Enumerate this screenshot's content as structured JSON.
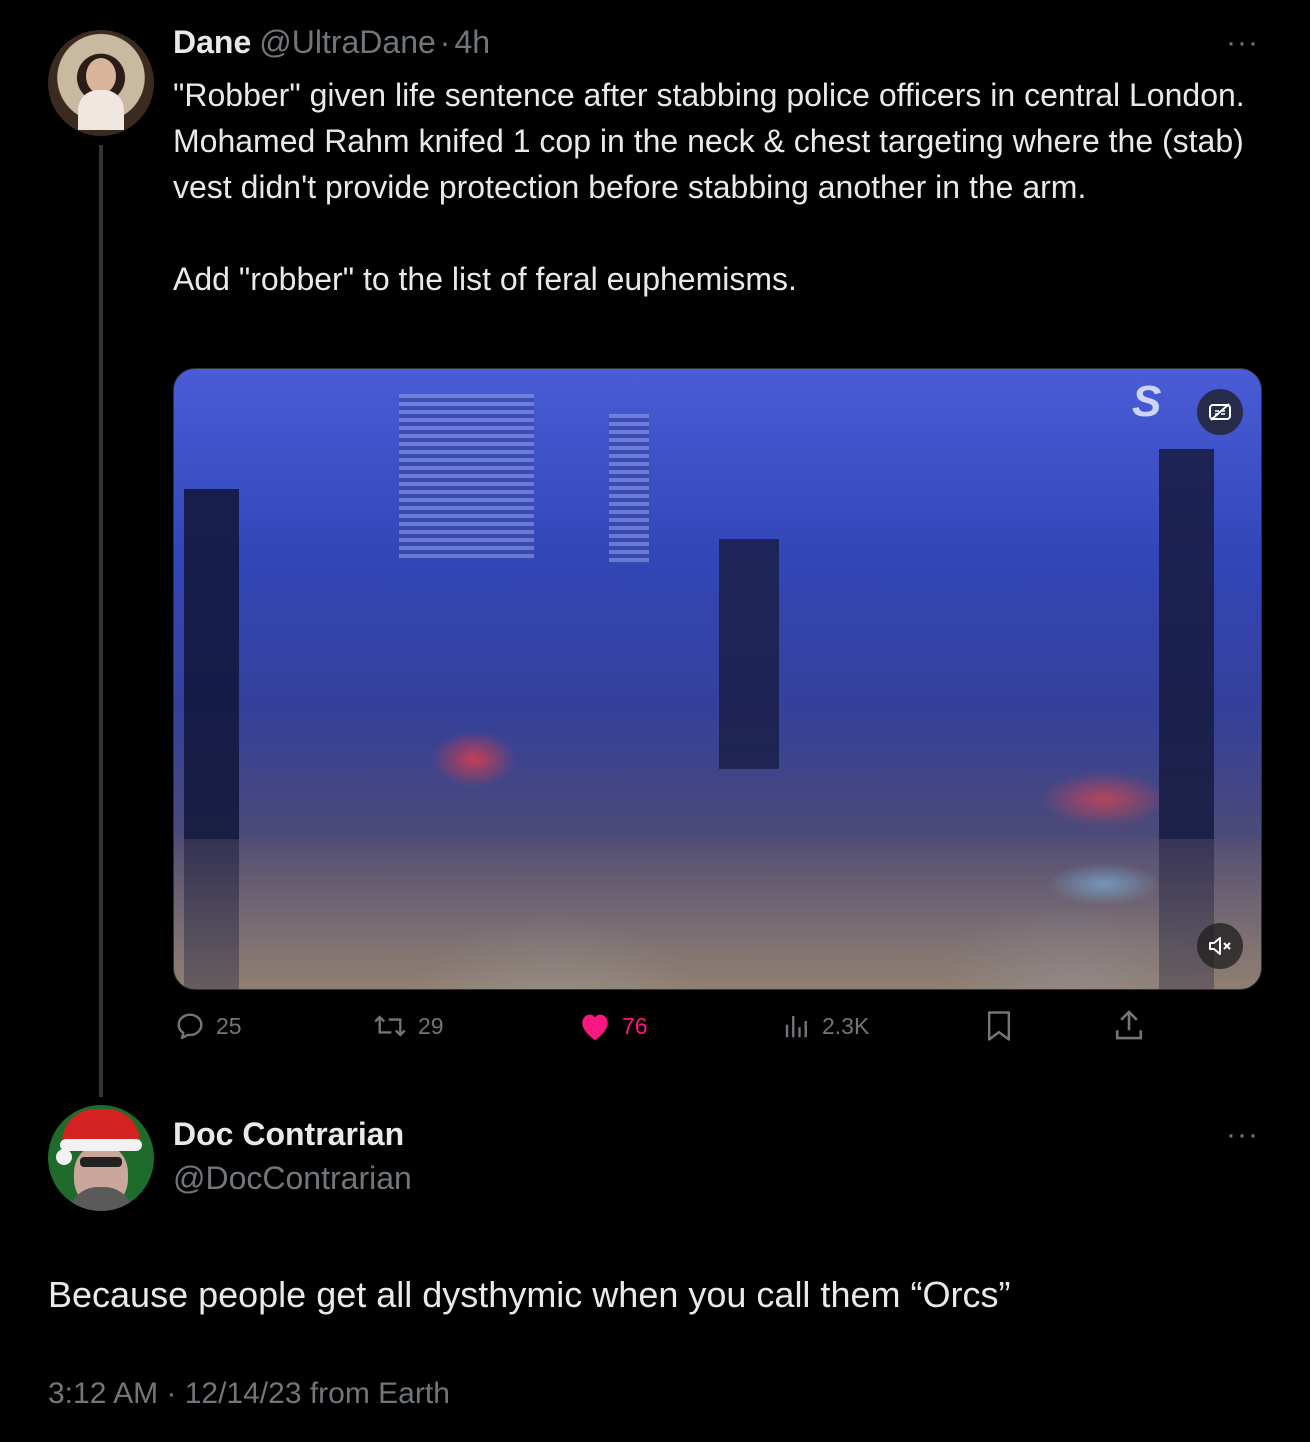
{
  "tweet": {
    "author_name": "Dane",
    "author_handle": "@UltraDane",
    "separator": "·",
    "time": "4h",
    "more": "···",
    "text": "\"Robber\" given life sentence after stabbing police officers in central London.  Mohamed Rahm knifed 1 cop in the neck & chest targeting where the (stab) vest didn't provide protection before stabbing another in the arm.\n\nAdd \"robber\" to the list of feral euphemisms.",
    "video": {
      "watermark": "S",
      "captions_icon": "captions-off-icon",
      "mute_icon": "volume-muted-icon"
    },
    "actions": {
      "replies": "25",
      "retweets": "29",
      "likes": "76",
      "views": "2.3K"
    },
    "colors": {
      "like": "#f91880",
      "muted": "#71767b"
    }
  },
  "reply": {
    "author_name": "Doc Contrarian",
    "author_handle": "@DocContrarian",
    "more": "···",
    "text": "Because people get all dysthymic when you call them “Orcs”",
    "timestamp": "3:12 AM · 12/14/23 from Earth"
  }
}
